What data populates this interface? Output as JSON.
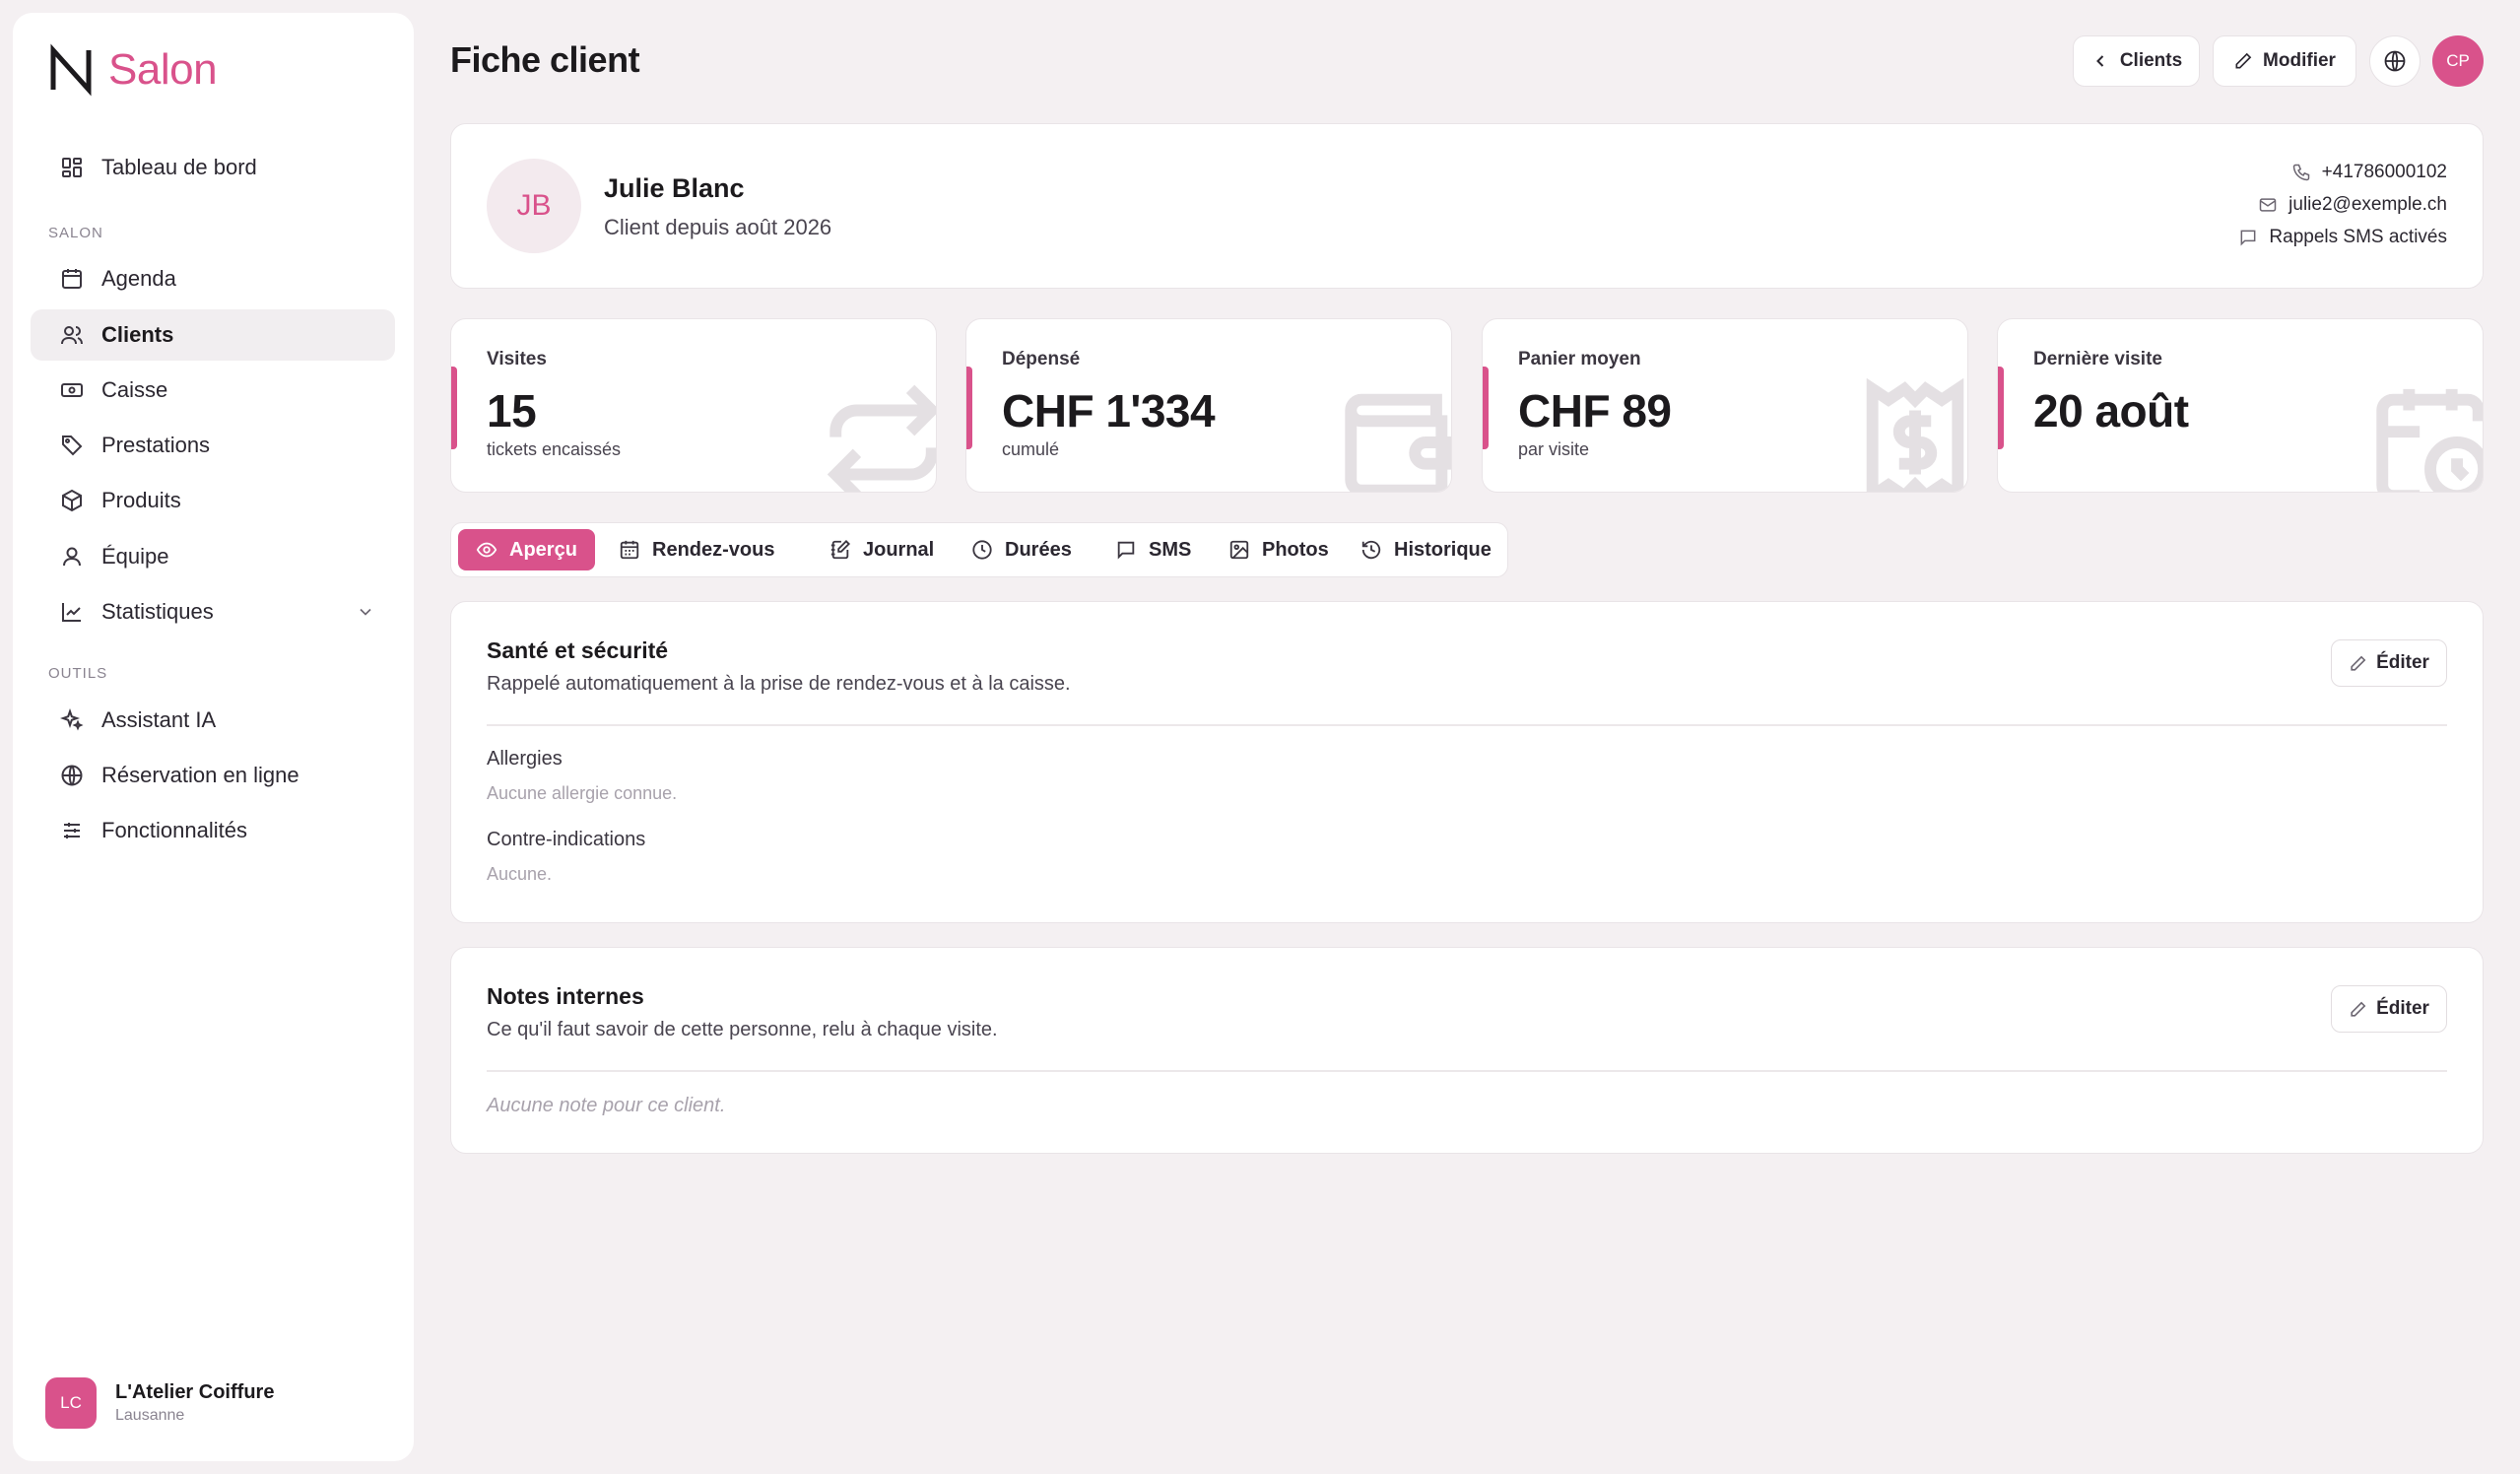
{
  "brand": {
    "name": "Salon",
    "accent": "#d9528b"
  },
  "sidebar": {
    "top_item": {
      "label": "Tableau de bord",
      "icon": "dashboard-icon"
    },
    "section_salon": "SALON",
    "salon_items": [
      {
        "label": "Agenda",
        "icon": "calendar-icon"
      },
      {
        "label": "Clients",
        "icon": "users-icon",
        "active": true
      },
      {
        "label": "Caisse",
        "icon": "cash-icon"
      },
      {
        "label": "Prestations",
        "icon": "tag-icon"
      },
      {
        "label": "Produits",
        "icon": "box-icon"
      },
      {
        "label": "Équipe",
        "icon": "user-icon"
      },
      {
        "label": "Statistiques",
        "icon": "chart-icon",
        "expandable": true
      }
    ],
    "section_tools": "OUTILS",
    "tool_items": [
      {
        "label": "Assistant IA",
        "icon": "sparkles-icon"
      },
      {
        "label": "Réservation en ligne",
        "icon": "globe-icon"
      },
      {
        "label": "Fonctionnalités",
        "icon": "sliders-icon"
      }
    ],
    "footer": {
      "initials": "LC",
      "name": "L'Atelier Coiffure",
      "city": "Lausanne"
    }
  },
  "header": {
    "title": "Fiche client",
    "back_label": "Clients",
    "edit_label": "Modifier",
    "user_initials": "CP"
  },
  "client": {
    "initials": "JB",
    "name": "Julie Blanc",
    "since": "Client depuis août 2026",
    "phone": "+41786000102",
    "email": "julie2@exemple.ch",
    "sms": "Rappels SMS activés"
  },
  "stats": [
    {
      "label": "Visites",
      "value": "15",
      "sub": "tickets encaissés",
      "icon": "repeat-icon"
    },
    {
      "label": "Dépensé",
      "value": "CHF 1'334",
      "sub": "cumulé",
      "icon": "wallet-icon"
    },
    {
      "label": "Panier moyen",
      "value": "CHF 89",
      "sub": "par visite",
      "icon": "receipt-icon"
    },
    {
      "label": "Dernière visite",
      "value": "20 août",
      "sub": "",
      "icon": "calendar-clock-icon"
    }
  ],
  "tabs": [
    {
      "label": "Aperçu",
      "icon": "eye-icon",
      "active": true
    },
    {
      "label": "Rendez-vous",
      "icon": "calendar-icon"
    },
    {
      "label": "Journal",
      "icon": "notebook-icon"
    },
    {
      "label": "Durées",
      "icon": "clock-icon"
    },
    {
      "label": "SMS",
      "icon": "message-icon"
    },
    {
      "label": "Photos",
      "icon": "image-icon"
    },
    {
      "label": "Historique",
      "icon": "history-icon"
    }
  ],
  "health": {
    "title": "Santé et sécurité",
    "subtitle": "Rappelé automatiquement à la prise de rendez-vous et à la caisse.",
    "edit_label": "Éditer",
    "allergies_label": "Allergies",
    "allergies_value": "Aucune allergie connue.",
    "contra_label": "Contre-indications",
    "contra_value": "Aucune."
  },
  "notes": {
    "title": "Notes internes",
    "subtitle": "Ce qu'il faut savoir de cette personne, relu à chaque visite.",
    "edit_label": "Éditer",
    "empty": "Aucune note pour ce client."
  }
}
